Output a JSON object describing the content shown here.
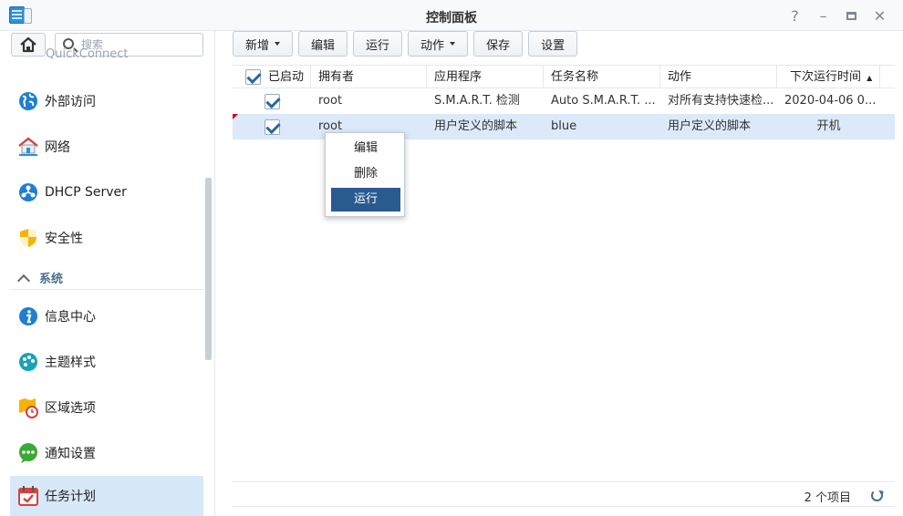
{
  "window": {
    "title": "控制面板"
  },
  "sidebar": {
    "search_placeholder": "搜索",
    "cut_item": "QuickConnect",
    "items": [
      {
        "label": "外部访问",
        "icon": "globe-icon"
      },
      {
        "label": "网络",
        "icon": "network-house-icon"
      },
      {
        "label": "DHCP Server",
        "icon": "dhcp-icon"
      },
      {
        "label": "安全性",
        "icon": "shield-icon"
      }
    ],
    "section": "系统",
    "sys_items": [
      {
        "label": "信息中心",
        "icon": "info-icon"
      },
      {
        "label": "主题样式",
        "icon": "palette-icon"
      },
      {
        "label": "区域选项",
        "icon": "region-clock-icon"
      },
      {
        "label": "通知设置",
        "icon": "notification-icon"
      },
      {
        "label": "任务计划",
        "icon": "calendar-check-icon"
      }
    ]
  },
  "toolbar": {
    "create": "新增",
    "edit": "编辑",
    "run": "运行",
    "action": "动作",
    "save": "保存",
    "settings": "设置"
  },
  "table": {
    "headers": [
      "已启动",
      "拥有者",
      "应用程序",
      "任务名称",
      "动作",
      "下次运行时间"
    ],
    "sort_indicator": "▲",
    "rows": [
      {
        "owner": "root",
        "app": "S.M.A.R.T. 检测",
        "name": "Auto S.M.A.R.T. ...",
        "action": "对所有支持快速检...",
        "next": "2020-04-06 0..."
      },
      {
        "owner": "root",
        "app": "用户定义的脚本",
        "name": "blue",
        "action": "用户定义的脚本",
        "next": "开机"
      }
    ]
  },
  "context_menu": {
    "edit": "编辑",
    "delete": "删除",
    "run": "运行"
  },
  "footer": {
    "count": "2 个项目"
  },
  "colors": {
    "accent": "#2a5b8f",
    "selection": "#dbe9f8",
    "active_nav": "#d7e8f8"
  }
}
